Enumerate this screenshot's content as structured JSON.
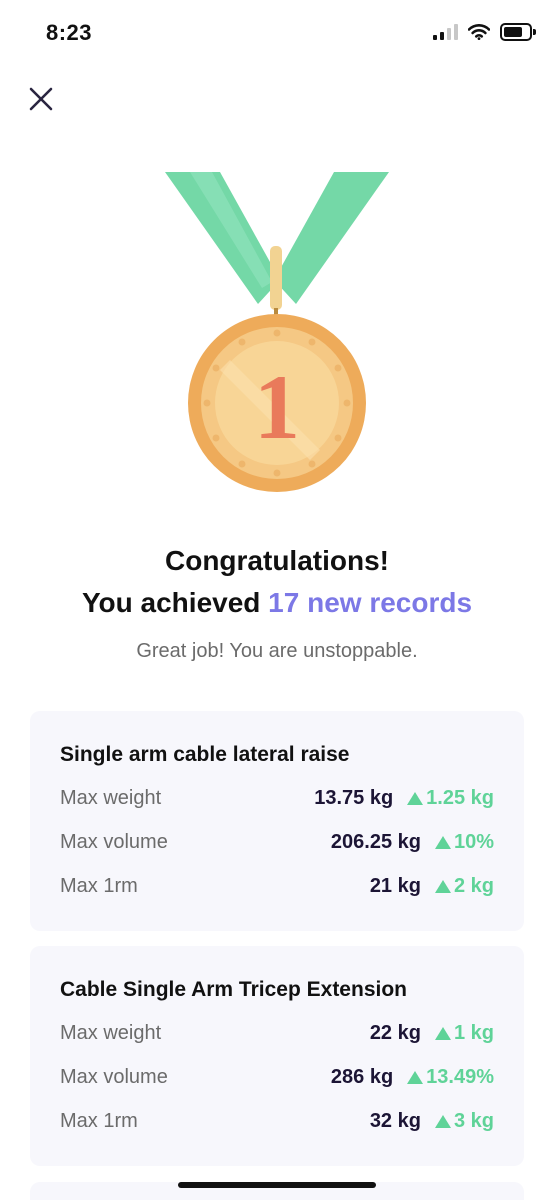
{
  "status_bar": {
    "time": "8:23"
  },
  "header": {
    "close_icon": "close-icon"
  },
  "hero": {
    "medal_icon": "gold-medal-icon",
    "medal_number": "1",
    "title": "Congratulations!",
    "subtitle_prefix": "You achieved",
    "subtitle_highlight": "17 new records",
    "tagline": "Great job! You are unstoppable."
  },
  "colors": {
    "accent": "#7c78e6",
    "positive": "#5fd398",
    "card_background": "#f7f7fc",
    "ribbon": "#74d8a7",
    "medal": "#eeab5a"
  },
  "records": [
    {
      "exercise": "Single arm cable lateral raise",
      "stats": [
        {
          "label": "Max weight",
          "value": "13.75 kg",
          "delta": "1.25 kg"
        },
        {
          "label": "Max volume",
          "value": "206.25 kg",
          "delta": "10%"
        },
        {
          "label": "Max 1rm",
          "value": "21 kg",
          "delta": "2 kg"
        }
      ]
    },
    {
      "exercise": "Cable Single Arm Tricep Extension",
      "stats": [
        {
          "label": "Max weight",
          "value": "22 kg",
          "delta": "1 kg"
        },
        {
          "label": "Max volume",
          "value": "286 kg",
          "delta": "13.49%"
        },
        {
          "label": "Max 1rm",
          "value": "32 kg",
          "delta": "3 kg"
        }
      ]
    }
  ]
}
